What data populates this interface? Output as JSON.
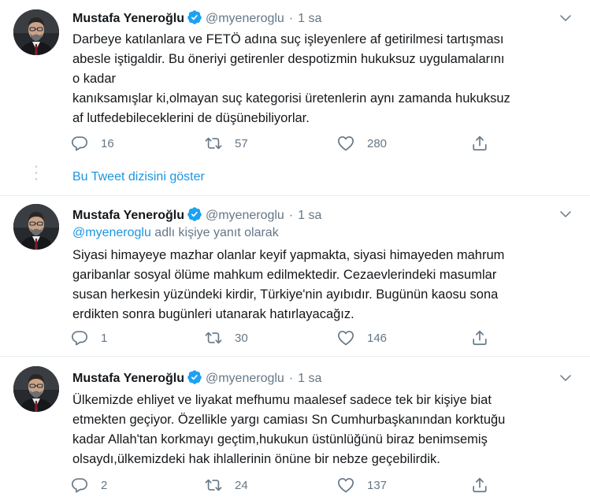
{
  "colors": {
    "link": "#1b95e0",
    "muted": "#657786",
    "text": "#14171a",
    "verified": "#1da1f2"
  },
  "icons": {
    "verified": "verified-badge-icon",
    "menu": "chevron-down-icon",
    "reply": "reply-icon",
    "retweet": "retweet-icon",
    "like": "heart-icon",
    "share": "share-icon"
  },
  "show_thread_label": "Bu Tweet dizisini göster",
  "tweets": [
    {
      "name": "Mustafa Yeneroğlu",
      "handle": "@myeneroglu",
      "time": "1 sa",
      "reply_to_handle": "",
      "reply_to_suffix": "",
      "lines": [
        "Darbeye katılanlara ve FETÖ adına suç işleyenlere af getirilmesi tartışması",
        "abesle iştigaldir. Bu öneriyi getirenler despotizmin hukuksuz uygulamalarını",
        "o kadar",
        "kanıksamışlar ki,olmayan suç kategorisi üretenlerin aynı zamanda hukuksuz",
        "af lutfedebileceklerini de düşünebiliyorlar."
      ],
      "replies": "16",
      "retweets": "57",
      "likes": "280"
    },
    {
      "name": "Mustafa Yeneroğlu",
      "handle": "@myeneroglu",
      "time": "1 sa",
      "reply_to_handle": "@myeneroglu",
      "reply_to_suffix": " adlı kişiye yanıt olarak",
      "lines": [
        "Siyasi himayeye mazhar olanlar keyif yapmakta, siyasi himayeden mahrum",
        "garibanlar sosyal ölüme mahkum edilmektedir. Cezaevlerindeki masumlar",
        "susan herkesin yüzündeki kirdir, Türkiye'nin ayıbıdır. Bugünün kaosu sona",
        "erdikten sonra bugünleri utanarak hatırlayacağız."
      ],
      "replies": "1",
      "retweets": "30",
      "likes": "146"
    },
    {
      "name": "Mustafa Yeneroğlu",
      "handle": "@myeneroglu",
      "time": "1 sa",
      "reply_to_handle": "",
      "reply_to_suffix": "",
      "lines": [
        "Ülkemizde ehliyet ve liyakat mefhumu maalesef sadece tek bir kişiye biat",
        "etmekten geçiyor. Özellikle yargı camiası Sn Cumhurbaşkanından korktuğu",
        "kadar Allah'tan korkmayı geçtim,hukukun üstünlüğünü biraz benimsemiş",
        "olsaydı,ülkemizdeki hak ihlallerinin önüne bir nebze geçebilirdik."
      ],
      "replies": "2",
      "retweets": "24",
      "likes": "137"
    }
  ]
}
